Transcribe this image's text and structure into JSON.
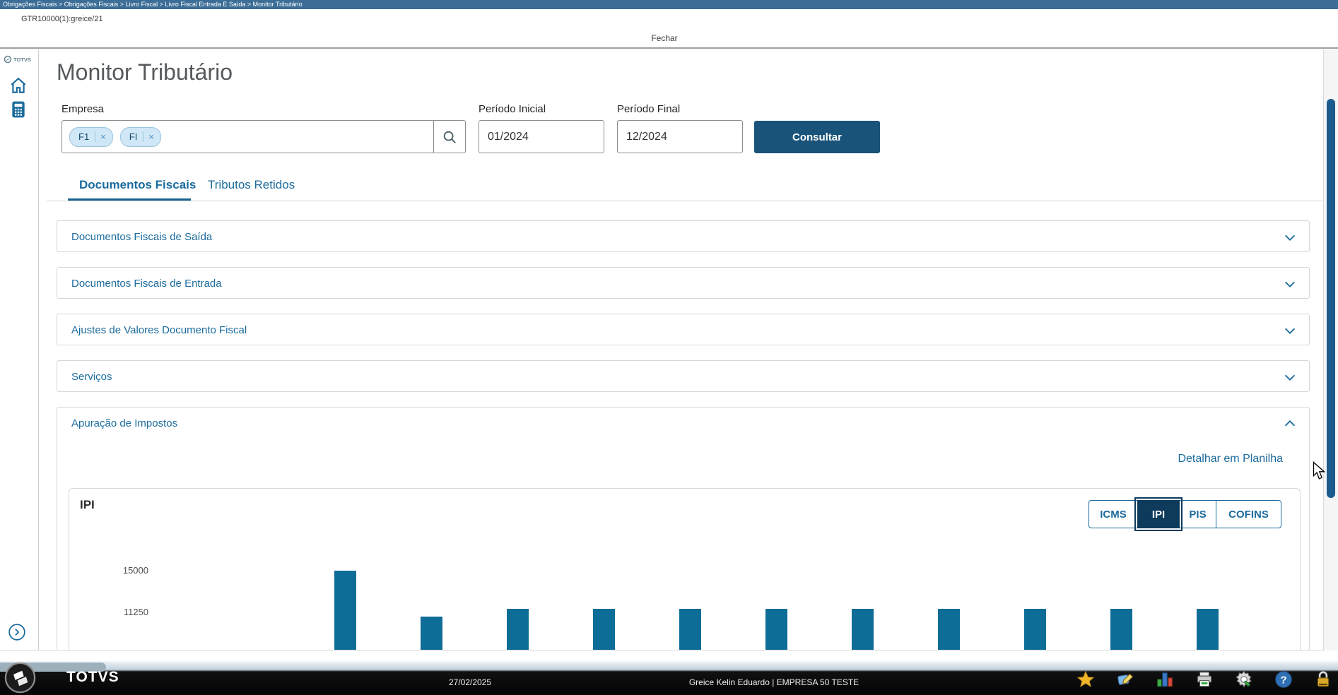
{
  "window": {
    "breadcrumb": "Obrigações Fiscais > Obrigações Fiscais > Livro Fiscal > Livro Fiscal Entrada E Saída > Monitor Tributário",
    "tab_label": "GTR10000(1):greice/21",
    "close_label": "Fechar"
  },
  "sidebar": {
    "brand": "TOTVS",
    "items": [
      {
        "name": "home",
        "icon": "home-icon"
      },
      {
        "name": "calculator",
        "icon": "calculator-icon"
      }
    ],
    "expand_icon": "chevron-right-circle-icon"
  },
  "page": {
    "title": "Monitor Tributário",
    "form": {
      "empresa_label": "Empresa",
      "empresa_tags": [
        "F1",
        "FI"
      ],
      "periodo_inicial_label": "Período Inicial",
      "periodo_inicial_value": "01/2024",
      "periodo_final_label": "Período Final",
      "periodo_final_value": "12/2024",
      "consultar_label": "Consultar"
    },
    "tabs": [
      {
        "label": "Documentos Fiscais",
        "active": true
      },
      {
        "label": "Tributos Retidos",
        "active": false
      }
    ],
    "panels": [
      {
        "label": "Documentos Fiscais de Saída",
        "expanded": false
      },
      {
        "label": "Documentos Fiscais de Entrada",
        "expanded": false
      },
      {
        "label": "Ajustes de Valores Documento Fiscal",
        "expanded": false
      },
      {
        "label": "Serviços",
        "expanded": false
      },
      {
        "label": "Apuração de Impostos",
        "expanded": true
      }
    ],
    "detail_link": "Detalhar em Planilha",
    "chart": {
      "title": "IPI",
      "tax_buttons": [
        "ICMS",
        "IPI",
        "PIS",
        "COFINS"
      ],
      "selected_tax": "IPI"
    }
  },
  "chart_data": {
    "type": "bar",
    "title": "IPI",
    "series": [
      {
        "name": "IPI",
        "values": [
          15000,
          10900,
          11550,
          11550,
          11550,
          11550,
          11550,
          11550,
          11550,
          11550,
          11550
        ]
      }
    ],
    "y_ticks_visible": [
      15000,
      11250
    ],
    "x_labels_visible": false,
    "note": "11 bars visible; chart truncated at bottom edge of viewport",
    "bar_color": "#0e6d96"
  },
  "taskbar": {
    "brand": "TOTVS",
    "date": "27/02/2025",
    "user_info": "Greice Kelin Eduardo | EMPRESA 50 TESTE",
    "tray_icons": [
      "favorites-star-icon",
      "edit-note-icon",
      "chart-3d-icon",
      "printer-icon",
      "settings-gear-icon",
      "help-icon",
      "lock-icon"
    ]
  },
  "colors": {
    "titlebar": "#3b6d96",
    "accent_blue": "#1b6b9d",
    "consultar_button": "#1a5379",
    "selected_tax_button": "#0e3a5c",
    "bar": "#0e6d96",
    "scroll_thumb": "#1b5b8d",
    "tag_background": "#cfe7f6"
  }
}
